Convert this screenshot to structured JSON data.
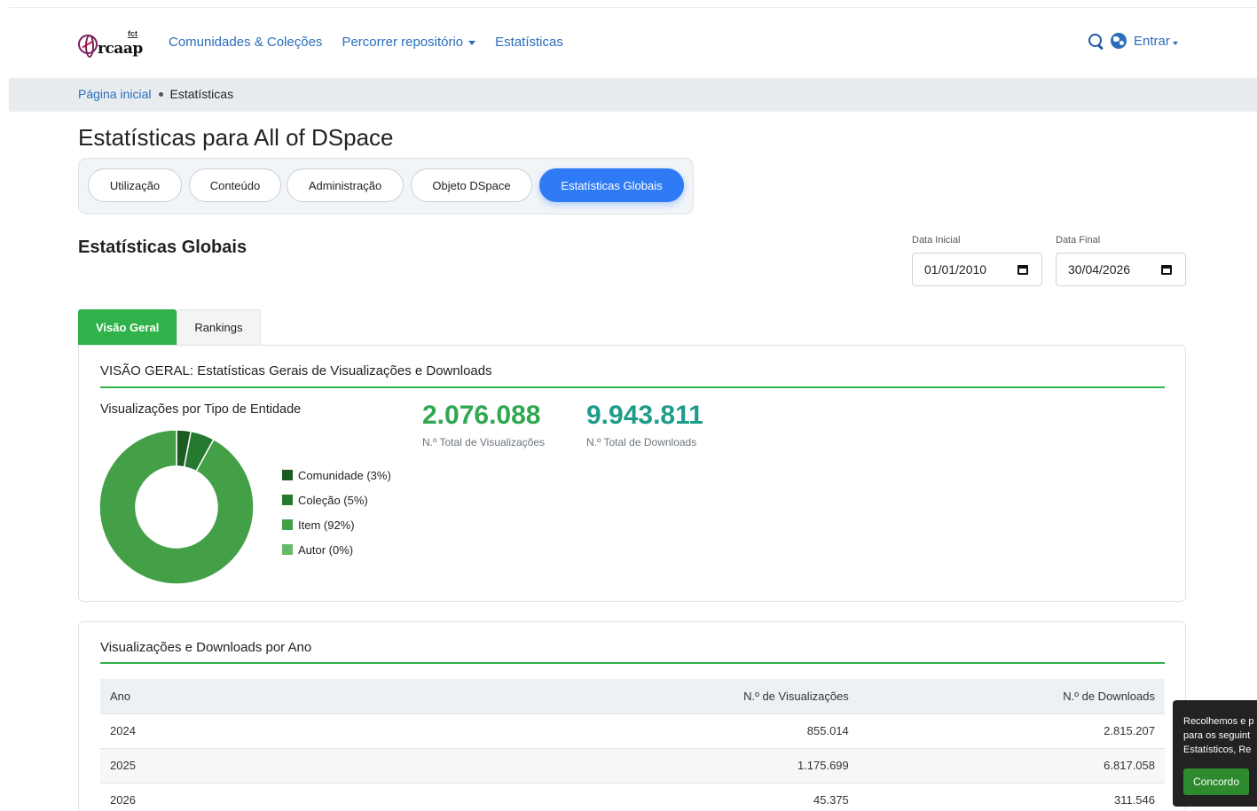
{
  "header": {
    "logo_fct": "fct",
    "logo_name": "rcaap",
    "nav": [
      {
        "label": "Comunidades & Coleções",
        "dropdown": false
      },
      {
        "label": "Percorrer repositório",
        "dropdown": true
      },
      {
        "label": "Estatísticas",
        "dropdown": false
      }
    ],
    "login_label": "Entrar"
  },
  "breadcrumb": {
    "home": "Página inicial",
    "current": "Estatísticas"
  },
  "page_title": "Estatísticas para All of DSpace",
  "report_tabs": [
    "Utilização",
    "Conteúdo",
    "Administração",
    "Objeto DSpace",
    "Estatísticas Globais"
  ],
  "section_title": "Estatísticas Globais",
  "dates": {
    "start_label": "Data Inicial",
    "start_value": "01/01/2010",
    "end_label": "Data Final",
    "end_value": "30/04/2026"
  },
  "content_tabs": [
    "Visão Geral",
    "Rankings"
  ],
  "overview": {
    "title": "VISÃO GERAL: Estatísticas Gerais de Visualizações e Downloads",
    "chart_title": "Visualizações por Tipo de Entidade",
    "total_views": "2.076.088",
    "total_views_label": "N.º Total de Visualizações",
    "total_downloads": "9.943.811",
    "total_downloads_label": "N.º Total de Downloads"
  },
  "chart_data": {
    "type": "pie",
    "title": "Visualizações por Tipo de Entidade",
    "series": [
      {
        "name": "Comunidade (3%)",
        "value": 3,
        "color": "#1a5c22"
      },
      {
        "name": "Coleção (5%)",
        "value": 5,
        "color": "#257a30"
      },
      {
        "name": "Item (92%)",
        "value": 92,
        "color": "#43a047"
      },
      {
        "name": "Autor (0%)",
        "value": 0,
        "color": "#66bb6a"
      }
    ],
    "legend": "right"
  },
  "yearly": {
    "title": "Visualizações e Downloads por Ano",
    "headers": [
      "Ano",
      "N.º de Visualizações",
      "N.º de Downloads"
    ],
    "rows": [
      [
        "2024",
        "855.014",
        "2.815.207"
      ],
      [
        "2025",
        "1.175.699",
        "6.817.058"
      ],
      [
        "2026",
        "45.375",
        "311.546"
      ]
    ]
  },
  "cookie": {
    "lines": [
      "Recolhemos e p",
      "para os seguint",
      "Estatísticos, Re"
    ],
    "button": "Concordo"
  },
  "colors": {
    "accent_green": "#2fb24a",
    "link_blue": "#2a6ebb",
    "pill_blue": "#2f7bf5",
    "views_green": "#2fa84f",
    "downloads_teal": "#1e9c8a"
  }
}
